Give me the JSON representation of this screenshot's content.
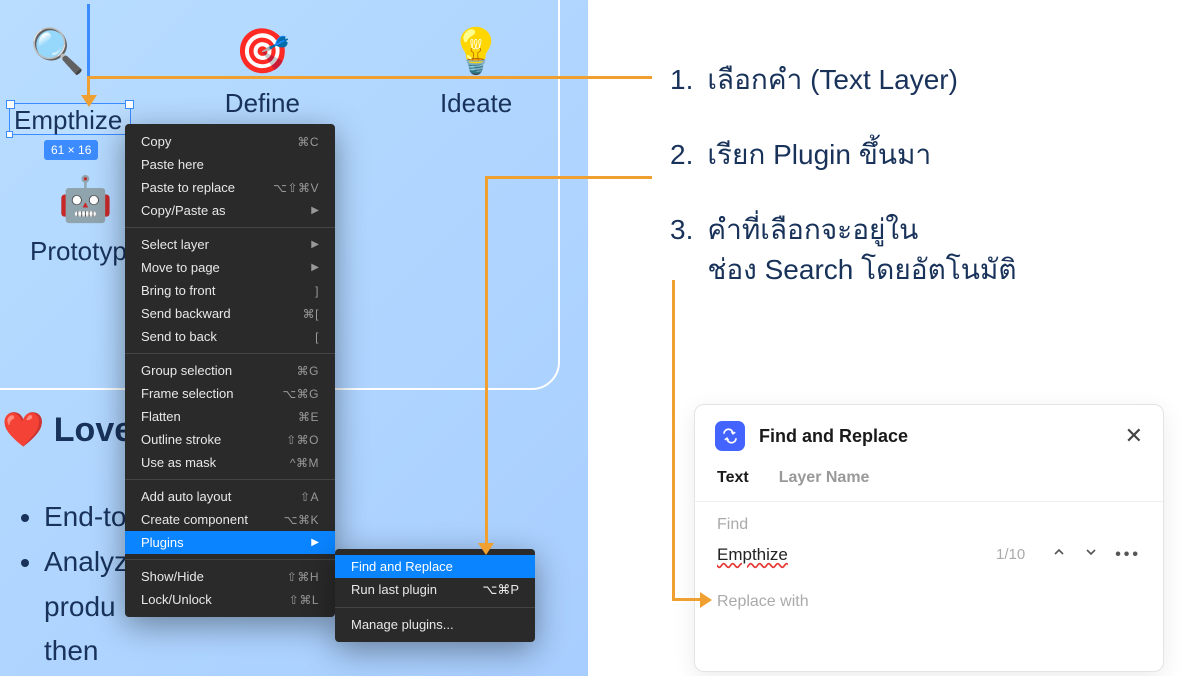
{
  "canvas": {
    "icons": [
      {
        "emoji": "🔍",
        "label": "Empthize"
      },
      {
        "emoji": "🎯",
        "label": "Define"
      },
      {
        "emoji": "💡",
        "label": "Ideate"
      }
    ],
    "prototype": {
      "emoji": "🤖",
      "label": "Prototype"
    },
    "selection_dims": "61 × 16",
    "love_heading": "❤️ Love",
    "bullets": [
      "End-to",
      "Analyz",
      "produ",
      "then"
    ]
  },
  "context_menu": {
    "groups": [
      [
        {
          "label": "Copy",
          "shortcut": "⌘C"
        },
        {
          "label": "Paste here",
          "shortcut": ""
        },
        {
          "label": "Paste to replace",
          "shortcut": "⌥⇧⌘V"
        },
        {
          "label": "Copy/Paste as",
          "shortcut": "",
          "submenu": true
        }
      ],
      [
        {
          "label": "Select layer",
          "shortcut": "",
          "submenu": true
        },
        {
          "label": "Move to page",
          "shortcut": "",
          "submenu": true
        },
        {
          "label": "Bring to front",
          "shortcut": "]"
        },
        {
          "label": "Send backward",
          "shortcut": "⌘["
        },
        {
          "label": "Send to back",
          "shortcut": "["
        }
      ],
      [
        {
          "label": "Group selection",
          "shortcut": "⌘G"
        },
        {
          "label": "Frame selection",
          "shortcut": "⌥⌘G"
        },
        {
          "label": "Flatten",
          "shortcut": "⌘E"
        },
        {
          "label": "Outline stroke",
          "shortcut": "⇧⌘O"
        },
        {
          "label": "Use as mask",
          "shortcut": "^⌘M"
        }
      ],
      [
        {
          "label": "Add auto layout",
          "shortcut": "⇧A"
        },
        {
          "label": "Create component",
          "shortcut": "⌥⌘K"
        },
        {
          "label": "Plugins",
          "shortcut": "",
          "submenu": true,
          "highlight": true
        }
      ],
      [
        {
          "label": "Show/Hide",
          "shortcut": "⇧⌘H"
        },
        {
          "label": "Lock/Unlock",
          "shortcut": "⇧⌘L"
        }
      ]
    ]
  },
  "submenu": {
    "items": [
      {
        "label": "Find and Replace",
        "shortcut": "",
        "highlight": true
      },
      {
        "label": "Run last plugin",
        "shortcut": "⌥⌘P"
      }
    ],
    "manage": "Manage plugins..."
  },
  "steps": [
    {
      "num": "1.",
      "text": "เลือกคำ (Text Layer)"
    },
    {
      "num": "2.",
      "text": "เรียก Plugin ขึ้นมา"
    },
    {
      "num": "3.",
      "text": "คำที่เลือกจะอยู่ใน\nช่อง Search โดยอัตโนมัติ"
    }
  ],
  "panel": {
    "title": "Find and Replace",
    "tabs": [
      "Text",
      "Layer Name"
    ],
    "active_tab": 0,
    "find_label": "Find",
    "find_value": "Empthize",
    "counter": "1/10",
    "replace_label": "Replace with"
  }
}
